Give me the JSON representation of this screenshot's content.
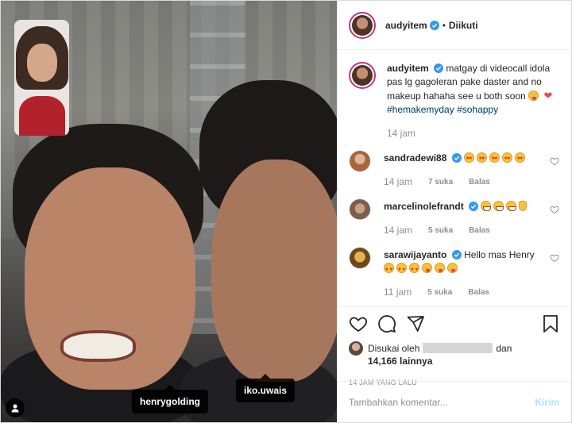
{
  "post": {
    "photo": {
      "tags": {
        "henry": "henrygolding",
        "iko": "iko.uwais"
      },
      "user_tag_icon": "person-icon"
    },
    "header": {
      "username": "audyitem",
      "separator": "•",
      "follow_status": "Diikuti",
      "verified_icon": "verified-badge-icon"
    },
    "caption": {
      "username": "audyitem",
      "text": "matgay di videocall idola pas lg gagoleran pake daster and no makeup hahaha see u both soon",
      "hashtags": [
        "#hemakemyday",
        "#sohappy"
      ],
      "time": "14 jam"
    },
    "comments": [
      {
        "username": "sandradewi88",
        "time": "14 jam",
        "likes": "7 suka",
        "reply": "Balas",
        "avatar_color": "#c98a5a"
      },
      {
        "username": "marcelinolefrandt",
        "time": "14 jam",
        "likes": "5 suka",
        "reply": "Balas",
        "avatar_color": "#8c6a55"
      },
      {
        "username": "sarawijayanto",
        "text": "Hello mas Henry",
        "time": "11 jam",
        "likes": "5 suka",
        "reply": "Balas",
        "avatar_color": "#c99a2e"
      }
    ],
    "likes": {
      "prefix": "Disukai oleh",
      "middle": "dan",
      "count": "14,166",
      "suffix": "lainnya"
    },
    "timestamp": "14 JAM YANG LALU",
    "add_comment": {
      "placeholder": "Tambahkan komentar...",
      "post_label": "Kirim"
    },
    "colors": {
      "verified": "#3897f0",
      "hashtag": "#00376b",
      "muted": "#8e8e8e",
      "story_ring": "#c13584",
      "post_disabled": "#b2dffc"
    }
  }
}
